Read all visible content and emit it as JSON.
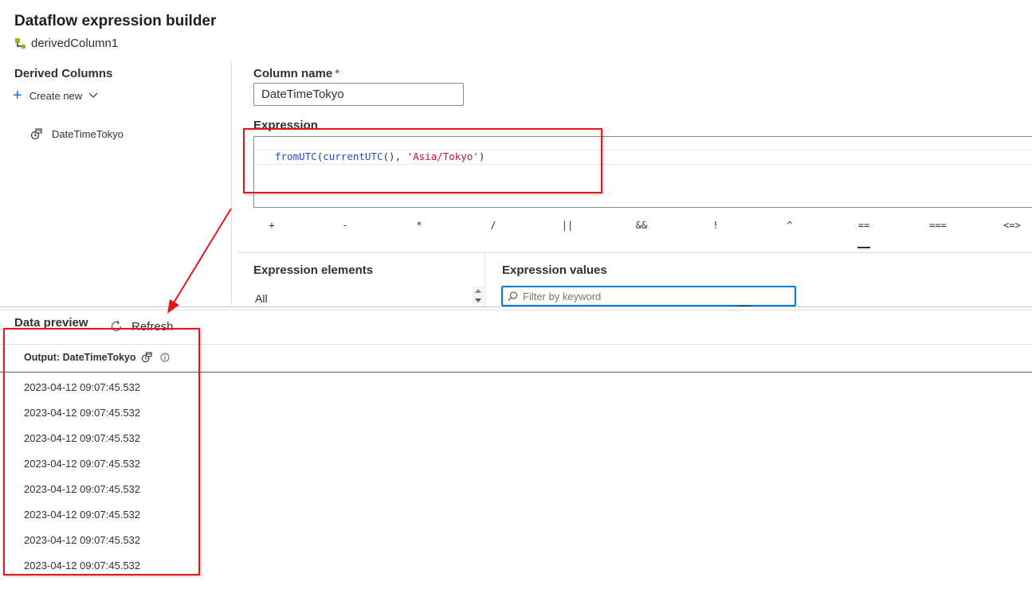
{
  "header": {
    "title": "Dataflow expression builder",
    "subtitle": "derivedColumn1"
  },
  "derived_columns": {
    "heading": "Derived Columns",
    "create_new_label": "Create new",
    "items": [
      {
        "label": "DateTimeTokyo"
      }
    ]
  },
  "column_name": {
    "label": "Column name",
    "required_mark": "*",
    "value": "DateTimeTokyo"
  },
  "expression": {
    "label": "Expression",
    "code": {
      "fn1": "fromUTC",
      "p1": "(",
      "fn2": "currentUTC",
      "p2": "(), ",
      "str": "'Asia/Tokyo'",
      "p3": ")"
    }
  },
  "operators": [
    "+",
    "-",
    "*",
    "/",
    "||",
    "&&",
    "!",
    "^",
    "==",
    "===",
    "<=>"
  ],
  "expression_elements": {
    "heading": "Expression elements",
    "selected": "All"
  },
  "expression_values": {
    "heading": "Expression values",
    "filter_placeholder": "Filter by keyword"
  },
  "data_preview": {
    "heading": "Data preview",
    "refresh_label": "Refresh",
    "column_header": "Output: DateTimeTokyo",
    "rows": [
      "2023-04-12 09:07:45.532",
      "2023-04-12 09:07:45.532",
      "2023-04-12 09:07:45.532",
      "2023-04-12 09:07:45.532",
      "2023-04-12 09:07:45.532",
      "2023-04-12 09:07:45.532",
      "2023-04-12 09:07:45.532",
      "2023-04-12 09:07:45.532"
    ]
  },
  "colors": {
    "accent": "#0078d4",
    "annotation_red": "#e8141c",
    "code_function": "#2050c8",
    "code_string": "#c8102e"
  }
}
